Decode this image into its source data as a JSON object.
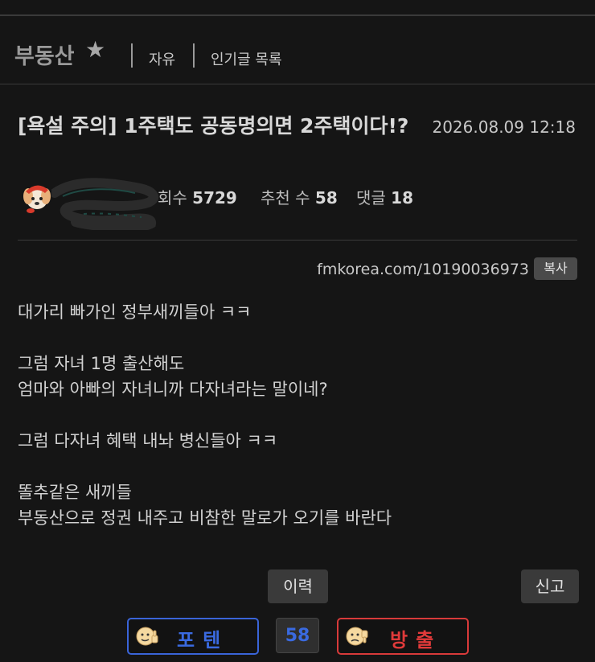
{
  "board": {
    "title": "부동산",
    "star_icon": "star-icon",
    "nav": [
      "자유",
      "인기글 목록"
    ]
  },
  "post": {
    "title": "[욕설 주의] 1주택도 공동명의면 2주택이다!?",
    "date": "2026.08.09 12:18",
    "author_avatar_icon": "dog-avatar-icon",
    "views_label": "회수",
    "views": "5729",
    "recommend_label": "추천 수",
    "recommend": "58",
    "comments_label": "댓글",
    "comments": "18",
    "url": "fmkorea.com/10190036973",
    "copy_label": "복사",
    "body": [
      "대가리 빠가인 정부새끼들아 ㅋㅋ",
      "",
      "그럼 자녀 1명 출산해도",
      "엄마와 아빠의 자녀니까 다자녀라는 말이네?",
      "",
      "그럼 다자녀 혜택 내놔 병신들아 ㅋㅋ",
      "",
      "똘추같은 새끼들",
      "부동산으로 정권 내주고 비참한 말로가 오기를 바란다"
    ]
  },
  "actions": {
    "history_label": "이력",
    "report_label": "신고",
    "upvote_label": "포텐",
    "vote_count": "58",
    "downvote_label": "방출",
    "upvote_color": "#3a64d8",
    "downvote_color": "#d83a3a"
  }
}
